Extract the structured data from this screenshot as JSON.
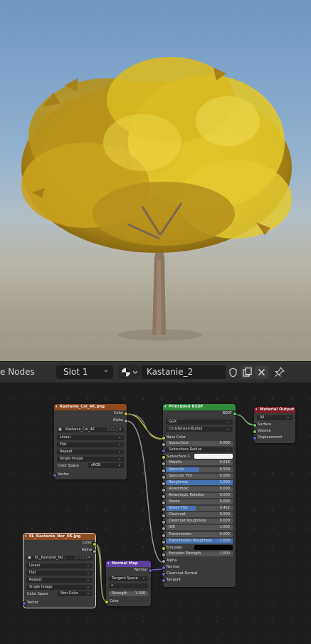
{
  "header": {
    "editor_title": "e Nodes",
    "slot_label": "Slot 1",
    "material_name": "Kastanie_2"
  },
  "nodes": {
    "color_tex": {
      "title": "Kastanie_Col_4K.png",
      "out_color": "Color",
      "out_alpha": "Alpha",
      "image_name": "Kastanie_Col_4K",
      "interpolation": "Linear",
      "projection": "Flat",
      "extension": "Repeat",
      "source": "Single Image",
      "color_space_label": "Color Space",
      "color_space": "sRGB",
      "in_vector": "Vector"
    },
    "normal_tex": {
      "title": "EL_Kastanie_Nor_4K.jpg",
      "out_color": "Color",
      "out_alpha": "Alpha",
      "image_name": "EL_Kastanie_No...",
      "interpolation": "Linear",
      "projection": "Flat",
      "extension": "Repeat",
      "source": "Single Image",
      "color_space_label": "Color Space",
      "color_space": "Non-Color",
      "in_vector": "Vector"
    },
    "normal_map": {
      "title": "Normal Map",
      "out_normal": "Normal",
      "space": "Tangent Space",
      "strength_label": "Strength",
      "strength": "1.000",
      "in_color": "Color"
    },
    "bsdf": {
      "title": "Principled BSDF",
      "out_bsdf": "BSDF",
      "distribution": "GGX",
      "subsurface_method": "Christensen-Burley",
      "inputs": [
        {
          "label": "Base Color",
          "value": "",
          "kind": "label"
        },
        {
          "label": "Subsurface",
          "value": "0.000",
          "kind": "num"
        },
        {
          "label": "Subsurface Radius",
          "value": "",
          "kind": "drop"
        },
        {
          "label": "Subsurface C",
          "value": "",
          "kind": "color"
        },
        {
          "label": "Metallic",
          "value": "0.018",
          "kind": "num"
        },
        {
          "label": "Specular",
          "value": "0.500",
          "kind": "bar",
          "fill": 0.5
        },
        {
          "label": "Specular Tint",
          "value": "0.000",
          "kind": "num"
        },
        {
          "label": "Roughness",
          "value": "1.000",
          "kind": "bar",
          "fill": 1.0
        },
        {
          "label": "Anisotropic",
          "value": "0.000",
          "kind": "num"
        },
        {
          "label": "Anisotropic Rotation",
          "value": "0.000",
          "kind": "num"
        },
        {
          "label": "Sheen",
          "value": "0.000",
          "kind": "num"
        },
        {
          "label": "Sheen Tint",
          "value": "0.452",
          "kind": "bar",
          "fill": 0.452
        },
        {
          "label": "Clearcoat",
          "value": "0.000",
          "kind": "num"
        },
        {
          "label": "Clearcoat Roughness",
          "value": "0.029",
          "kind": "num"
        },
        {
          "label": "IOR",
          "value": "1.000",
          "kind": "num"
        },
        {
          "label": "Transmission",
          "value": "0.000",
          "kind": "num"
        },
        {
          "label": "Transmission Roughness",
          "value": "1.000",
          "kind": "bar",
          "fill": 1.0
        },
        {
          "label": "Emission",
          "value": "",
          "kind": "black"
        },
        {
          "label": "Emission Strength",
          "value": "1.000",
          "kind": "num"
        },
        {
          "label": "Alpha",
          "value": "",
          "kind": "label"
        },
        {
          "label": "Normal",
          "value": "",
          "kind": "label"
        },
        {
          "label": "Clearcoat Normal",
          "value": "",
          "kind": "label"
        },
        {
          "label": "Tangent",
          "value": "",
          "kind": "label"
        }
      ]
    },
    "output": {
      "title": "Material Output",
      "target": "All",
      "inputs": [
        "Surface",
        "Volume",
        "Displacement"
      ]
    }
  },
  "colors": {
    "texture_header": "#8b4a22",
    "vector_header": "#5f3fa0",
    "shader_header": "#2f8a3c",
    "output_header": "#7a1c26",
    "socket_color": "#c7c729",
    "socket_float": "#a1a1a1",
    "socket_vector": "#6363c7",
    "socket_shader": "#63c763"
  }
}
